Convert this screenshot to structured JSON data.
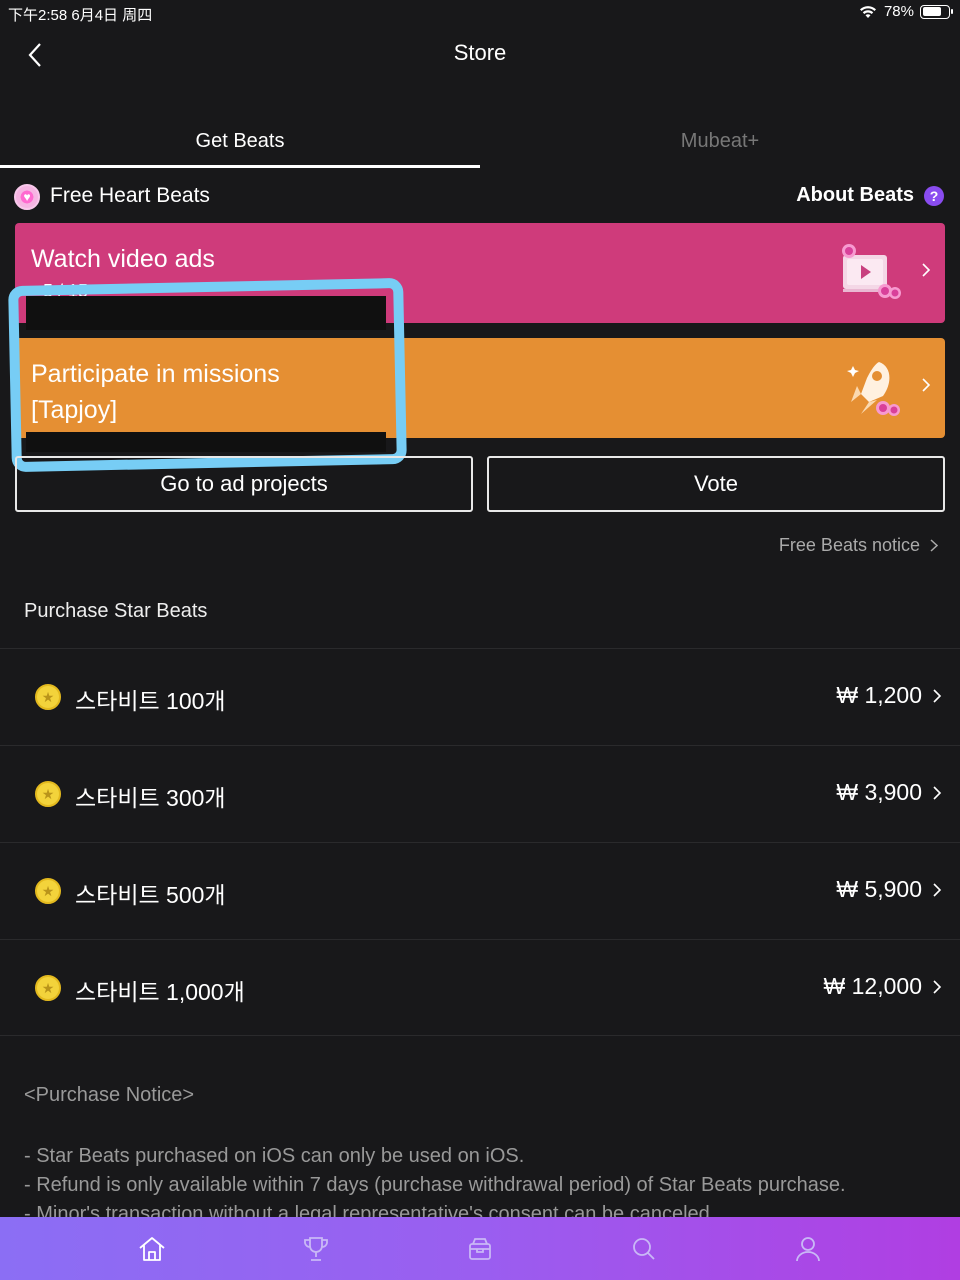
{
  "status_bar": {
    "time_date": "下午2:58   6月4日 周四",
    "battery": "78%",
    "battery_level": 0.78
  },
  "nav": {
    "title": "Store"
  },
  "tabs": [
    {
      "label": "Get Beats",
      "active": true
    },
    {
      "label": "Mubeat+",
      "active": false
    }
  ],
  "free_section": {
    "title": "Free Heart Beats",
    "about_label": "About Beats",
    "help_icon": "?"
  },
  "cards": [
    {
      "title": "Watch video ads",
      "subtitle": "5 / 15",
      "icon": "video-play-icon",
      "color": "#cf3b7b"
    },
    {
      "title_line1": "Participate in missions",
      "title_line2": "[Tapjoy]",
      "icon": "rocket-icon",
      "color": "#e58f33"
    }
  ],
  "buttons": {
    "ad_projects": "Go to ad projects",
    "vote": "Vote"
  },
  "free_notice_link": "Free Beats notice",
  "purchase": {
    "title": "Purchase Star Beats",
    "items": [
      {
        "label": "스타비트 100개",
        "price": "₩ 1,200"
      },
      {
        "label": "스타비트 300개",
        "price": "₩ 3,900"
      },
      {
        "label": "스타비트 500개",
        "price": "₩ 5,900"
      },
      {
        "label": "스타비트 1,000개",
        "price": "₩ 12,000"
      }
    ]
  },
  "purchase_notice": {
    "title": "<Purchase Notice>",
    "lines": [
      "- Star Beats purchased on iOS can only be used on iOS.",
      "- Refund is only available within 7 days (purchase withdrawal period) of Star Beats purchase.",
      "- Minor's transaction without a legal representative's consent can be canceled."
    ]
  },
  "bottom_nav": [
    "home-icon",
    "trophy-icon",
    "store-icon",
    "search-icon",
    "profile-icon"
  ],
  "colors": {
    "background": "#18181a",
    "pink": "#cf3b7b",
    "orange": "#e58f33",
    "highlight": "#77cdf5",
    "coin": "#f3d33b",
    "accent": "#8a4cf0"
  }
}
